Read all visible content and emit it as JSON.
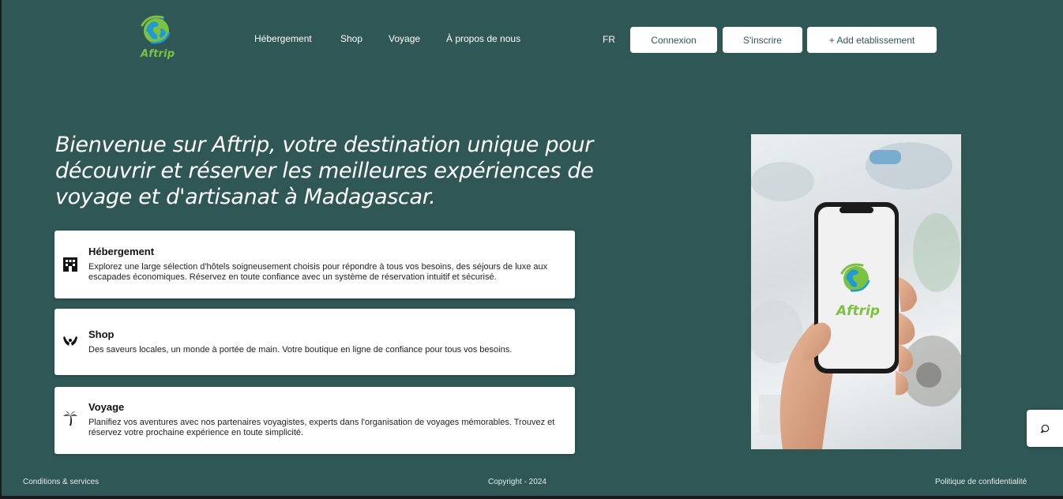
{
  "brand": {
    "name": "Aftrip"
  },
  "nav": {
    "items": [
      {
        "label": "Hébergement"
      },
      {
        "label": "Shop"
      },
      {
        "label": "Voyage"
      },
      {
        "label": "À propos de nous"
      }
    ],
    "language": "FR",
    "login_label": "Connexion",
    "signup_label": "S'inscrire",
    "add_label": "+ Add etablissement"
  },
  "hero": {
    "title": "Bienvenue sur Aftrip, votre destination unique pour découvrir et réserver les meilleures expériences de voyage et d'artisanat à Madagascar."
  },
  "cards": [
    {
      "icon": "building-icon",
      "title": "Hébergement",
      "description": "Explorez une large sélection d'hôtels soigneusement choisis pour répondre à tous vos besoins, des séjours de luxe aux escapades économiques. Réservez en toute confiance avec un système de réservation intuitif et sécurisé."
    },
    {
      "icon": "hands-icon",
      "title": "Shop",
      "description": "Des saveurs locales, un monde à portée de main. Votre boutique en ligne de confiance pour tous vos besoins."
    },
    {
      "icon": "palm-tree-icon",
      "title": "Voyage",
      "description": "Planifiez vos aventures avec nos partenaires voyagistes, experts dans l'organisation de voyages mémorables. Trouvez et réservez votre prochaine expérience en toute simplicité."
    }
  ],
  "chat": {
    "icon": "chat-bubble-icon"
  },
  "footer": {
    "terms": "Conditions & services",
    "copyright": "Copyright - 2024",
    "privacy": "Politique de confidentialité"
  },
  "colors": {
    "background": "#2f5755",
    "brand_green": "#7cc242",
    "brand_blue": "#1f9ad6"
  }
}
